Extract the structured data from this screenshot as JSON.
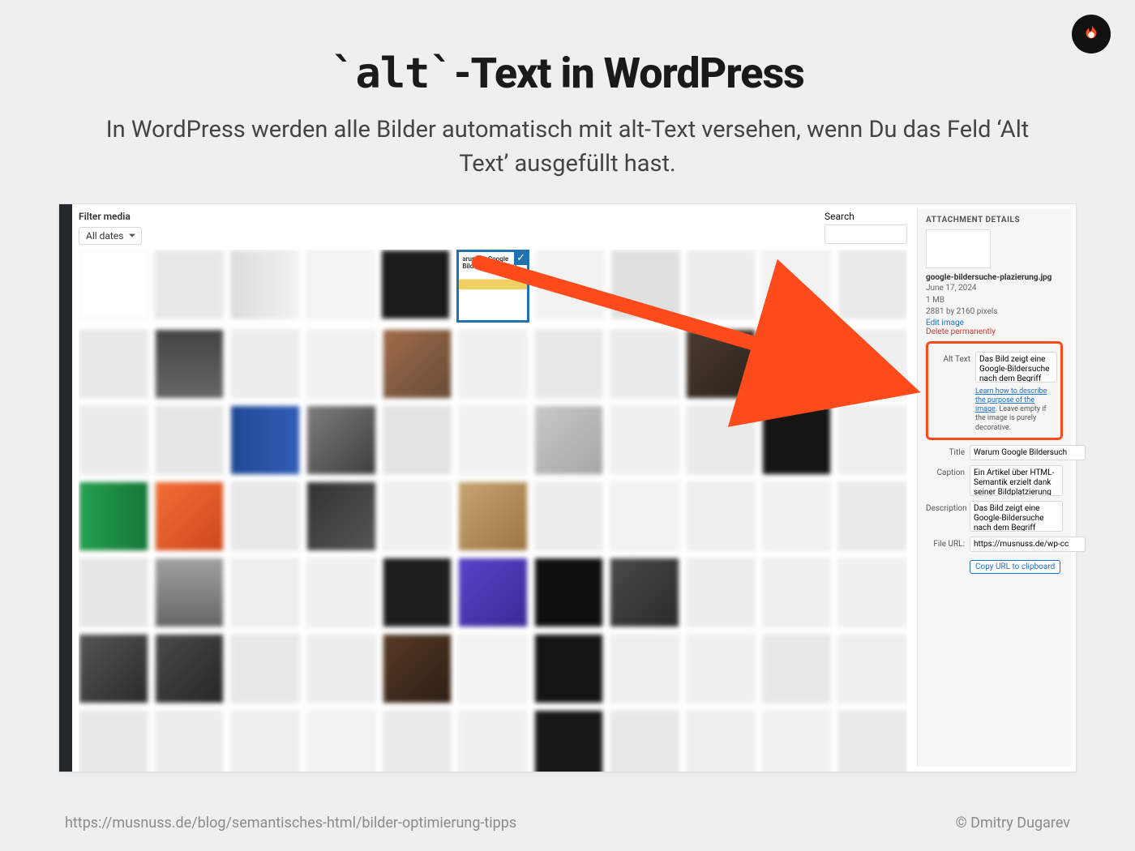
{
  "title_prefix": "`alt`",
  "title_suffix": "-Text in WordPress",
  "subtitle": "In WordPress werden alle Bilder automatisch mit alt-Text versehen, wenn Du das Feld ‘Alt Text’ ausgefüllt hast.",
  "toolbar": {
    "filter_label": "Filter media",
    "all_dates": "All dates",
    "search_label": "Search"
  },
  "selected_caption": "arum ist Google Bildsuche wichtig?",
  "details": {
    "heading": "ATTACHMENT DETAILS",
    "filename": "google-bildersuche-plazierung.jpg",
    "date": "June 17, 2024",
    "size": "1 MB",
    "dims": "2881 by 2160 pixels",
    "edit": "Edit image",
    "delete": "Delete permanently",
    "alt_label": "Alt Text",
    "alt_value": "Das Bild zeigt eine Google-Bildersuche nach dem Begriff",
    "alt_help_link": "Learn how to describe the purpose of the image",
    "alt_help_rest": ". Leave empty if the image is purely decorative.",
    "title_label": "Title",
    "title_value": "Warum Google Bildersuch",
    "caption_label": "Caption",
    "caption_value": "Ein Artikel über HTML-Semantik erzielt dank seiner Bildplatzierung",
    "desc_label": "Description",
    "desc_value": "Das Bild zeigt eine Google-Bildersuche nach dem Begriff",
    "url_label": "File URL:",
    "url_value": "https://musnuss.de/wp-cc",
    "copy": "Copy URL to clipboard"
  },
  "footer": {
    "url": "https://musnuss.de/blog/semantisches-html/bilder-optimierung-tipps",
    "credit": "© Dmitry Dugarev"
  },
  "tiles": [
    [
      "#fff",
      "#e8e8e8",
      "linear-gradient(90deg,#dcdcdc,#f2f2f2)",
      "#f3f3f3",
      "#1b1b1b",
      "SELECTED",
      "#f2f2f2",
      "#e0e0e0",
      "#ededed",
      "#f2f2f2",
      "#eaeaea"
    ],
    [
      "#e9e9e9",
      "linear-gradient(180deg,#444,#666)",
      "#ededed",
      "#f1f1f1",
      "linear-gradient(135deg,#a36b45,#6b4a34)",
      "#f0f0f0",
      "#e8e8e8",
      "#ebebeb",
      "linear-gradient(135deg,#4a3a2e,#2d241d)",
      "#151515",
      "#efefef"
    ],
    [
      "#ececec",
      "#e6e6e6",
      "linear-gradient(90deg,#1d4aa0,#2c5cc0)",
      "linear-gradient(135deg,#7d7d7d,#3e3e3e)",
      "#e3e3e3",
      "#f1f1f1",
      "linear-gradient(135deg,#c8c8c8,#a6a6a6)",
      "#f0f0f0",
      "#eaeaea",
      "#151515",
      "#efefef"
    ],
    [
      "linear-gradient(90deg,#1aa34a,#0c7a33)",
      "linear-gradient(135deg,#ff6a2b,#d94614)",
      "#e8e8e8",
      "linear-gradient(135deg,#333,#555)",
      "#f0f0f0",
      "linear-gradient(135deg,#caa46a,#a0763e)",
      "#ededed",
      "#f2f2f2",
      "#efefef",
      "#f1f1f1",
      "#eaeaea"
    ],
    [
      "#e7e7e7",
      "linear-gradient(180deg,#a0a0a0,#666)",
      "#eeeeee",
      "#f0f0f0",
      "#1e1e1e",
      "linear-gradient(135deg,#5b40d6,#3a2aa0)",
      "#0f0f0f",
      "linear-gradient(135deg,#4a4a4a,#2a2a2a)",
      "#ededed",
      "#efefef",
      "#f0f0f0"
    ],
    [
      "linear-gradient(135deg,#555,#2a2a2a)",
      "linear-gradient(135deg,#4a4a4a,#262626)",
      "#e8e8e8",
      "#ededed",
      "linear-gradient(135deg,#5a3a22,#2f1e12)",
      "#f2f2f2",
      "#141414",
      "#efefef",
      "#f0f0f0",
      "#e8e8e8",
      "#efefef"
    ],
    [
      "#e8e8e8",
      "#ededed",
      "#efefef",
      "#f2f2f2",
      "#eaeaea",
      "#f0f0f0",
      "#181818",
      "#e8e8e8",
      "#efefef",
      "#f1f1f1",
      "#eaeaea"
    ]
  ]
}
